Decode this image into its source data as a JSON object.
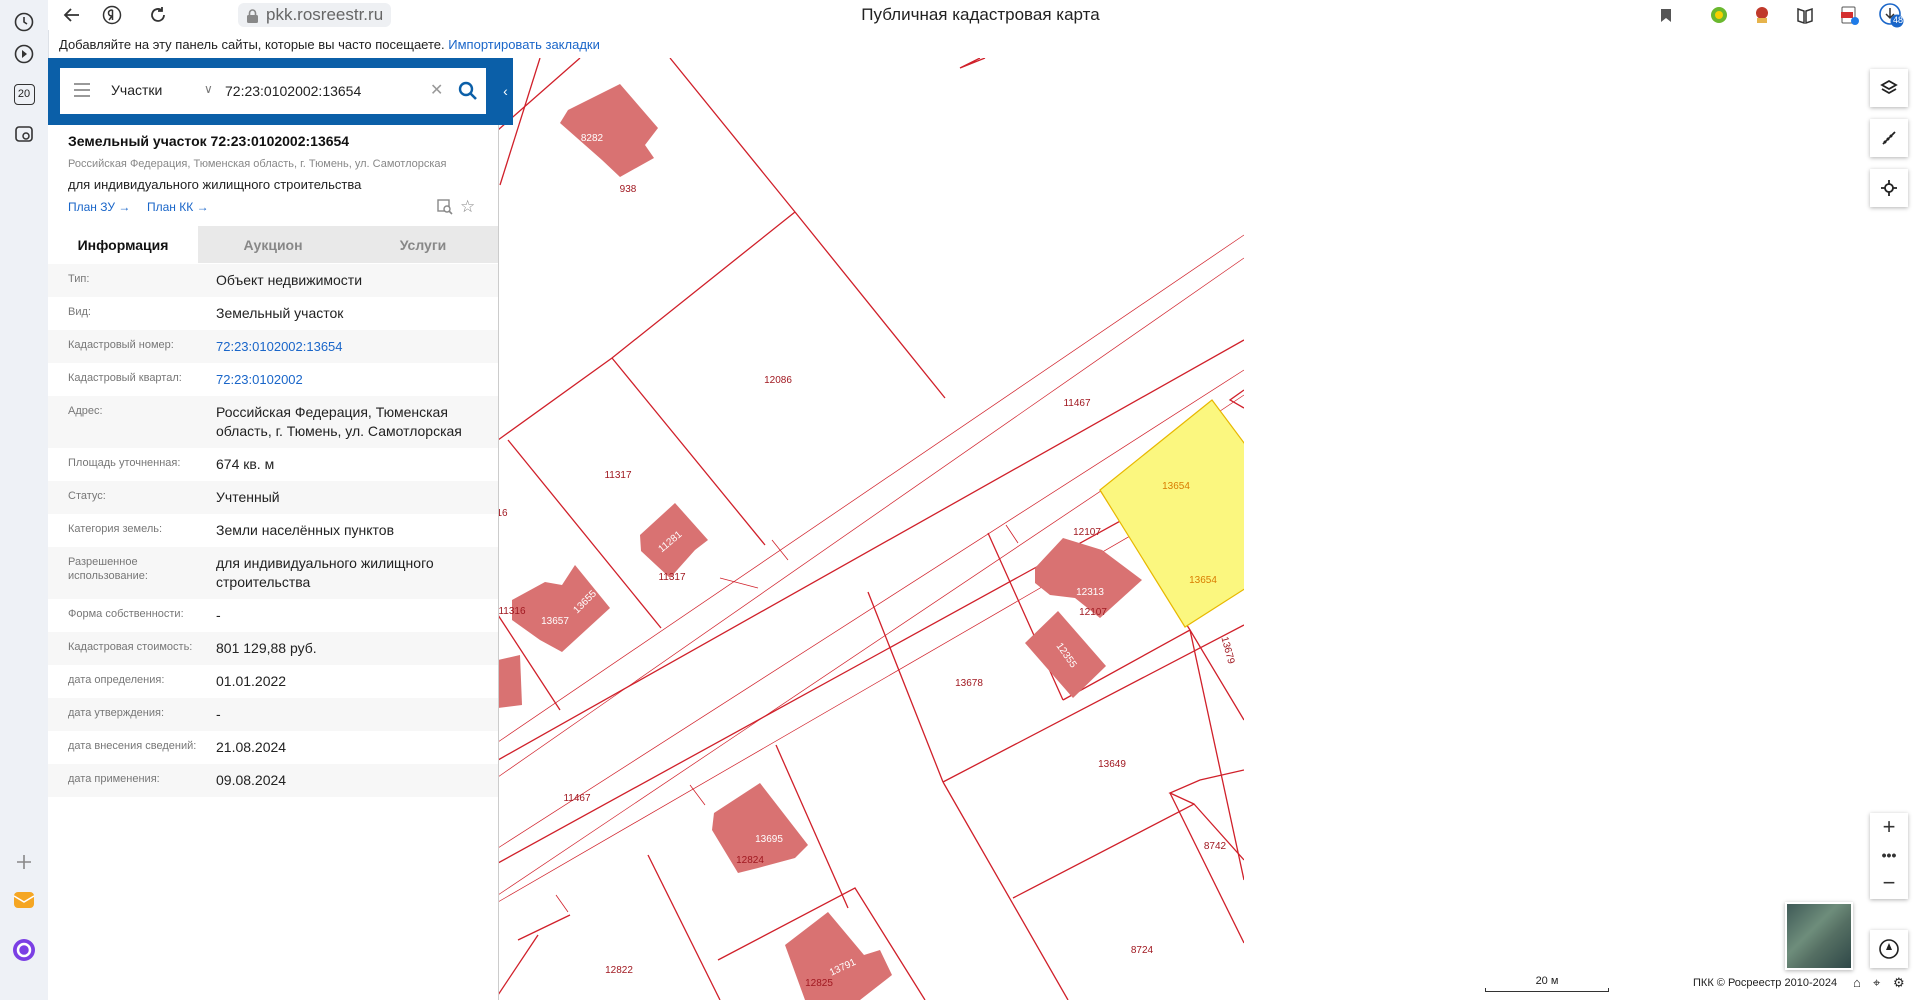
{
  "browser": {
    "url": "pkk.rosreestr.ru",
    "page_title": "Публичная кадастровая карта",
    "bookmarks_hint": "Добавляйте на эту панель сайты, которые вы часто посещаете.",
    "import_bookmarks": "Импортировать закладки",
    "sidebar_badge": "20",
    "downloads_badge": "48"
  },
  "search": {
    "type_label": "Участки",
    "value": "72:23:0102002:13654"
  },
  "object": {
    "title": "Земельный участок 72:23:0102002:13654",
    "address": "Российская Федерация, Тюменская область, г. Тюмень, ул. Самотлорская",
    "purpose": "для индивидуального жилищного строительства",
    "plan_zu": "План ЗУ →",
    "plan_kk": "План КК →"
  },
  "tabs": [
    "Информация",
    "Аукцион",
    "Услуги"
  ],
  "info_rows": [
    {
      "key": "Тип:",
      "value": "Объект недвижимости"
    },
    {
      "key": "Вид:",
      "value": "Земельный участок"
    },
    {
      "key": "Кадастровый номер:",
      "value": "72:23:0102002:13654",
      "link": true
    },
    {
      "key": "Кадастровый квартал:",
      "value": "72:23:0102002",
      "link": true
    },
    {
      "key": "Адрес:",
      "value": "Российская Федерация, Тюменская область, г. Тюмень, ул. Самотлорская"
    },
    {
      "key": "Площадь уточненная:",
      "value": "674 кв. м"
    },
    {
      "key": "Статус:",
      "value": "Учтенный"
    },
    {
      "key": "Категория земель:",
      "value": "Земли населённых пунктов"
    },
    {
      "key": "Разрешенное использование:",
      "value": "для индивидуального жилищного строительства"
    },
    {
      "key": "Форма собственности:",
      "value": "-"
    },
    {
      "key": "Кадастровая стоимость:",
      "value": "801 129,88 руб."
    },
    {
      "key": "дата определения:",
      "value": "01.01.2022"
    },
    {
      "key": "дата утверждения:",
      "value": "-"
    },
    {
      "key": "дата внесения сведений:",
      "value": "21.08.2024"
    },
    {
      "key": "дата применения:",
      "value": "09.08.2024"
    }
  ],
  "map": {
    "labels": {
      "l8282": "8282",
      "l938": "938",
      "l12086": "12086",
      "l11467a": "11467",
      "l11317a": "11317",
      "l11281": "11281",
      "l11317b": "11317",
      "l16": "16",
      "l13654a": "13654",
      "l13654b": "13654",
      "l12107a": "12107",
      "l12313": "12313",
      "l12107b": "12107",
      "l12355": "12355",
      "l13657": "13657",
      "l13655": "13655",
      "l11316": "11316",
      "l13678": "13678",
      "l13679": "13679",
      "l13649": "13649",
      "l11467b": "11467",
      "l8742": "8742",
      "l13695": "13695",
      "l12824": "12824",
      "l8724": "8724",
      "l12822": "12822",
      "l13791": "13791",
      "l12825": "12825"
    },
    "colors": {
      "parcel_line": "#d0202a",
      "building": "#d97272",
      "selected": "#fbf77f"
    },
    "scale_label": "20 м",
    "copyright": "ПКК © Росреестр 2010-2024"
  }
}
